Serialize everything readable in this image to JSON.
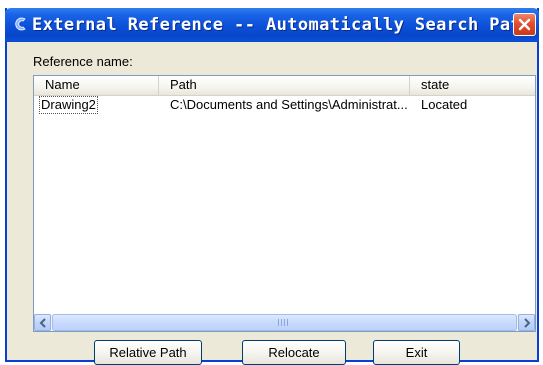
{
  "window": {
    "title": "External Reference -- Automatically Search Path",
    "accent_color": "#0a4fd8",
    "close_color": "#e0502e"
  },
  "reference_label": "Reference name:",
  "list": {
    "columns": [
      "Name",
      "Path",
      "state"
    ],
    "rows": [
      {
        "name": "Drawing2",
        "path": "C:\\Documents and Settings\\Administrat...",
        "state": "Located"
      }
    ]
  },
  "buttons": {
    "relative_path": "Relative Path",
    "relocate": "Relocate",
    "exit": "Exit"
  },
  "icons": {
    "app": "app-icon",
    "close": "close-icon",
    "scroll_left": "left-arrow-icon",
    "scroll_right": "right-arrow-icon"
  }
}
